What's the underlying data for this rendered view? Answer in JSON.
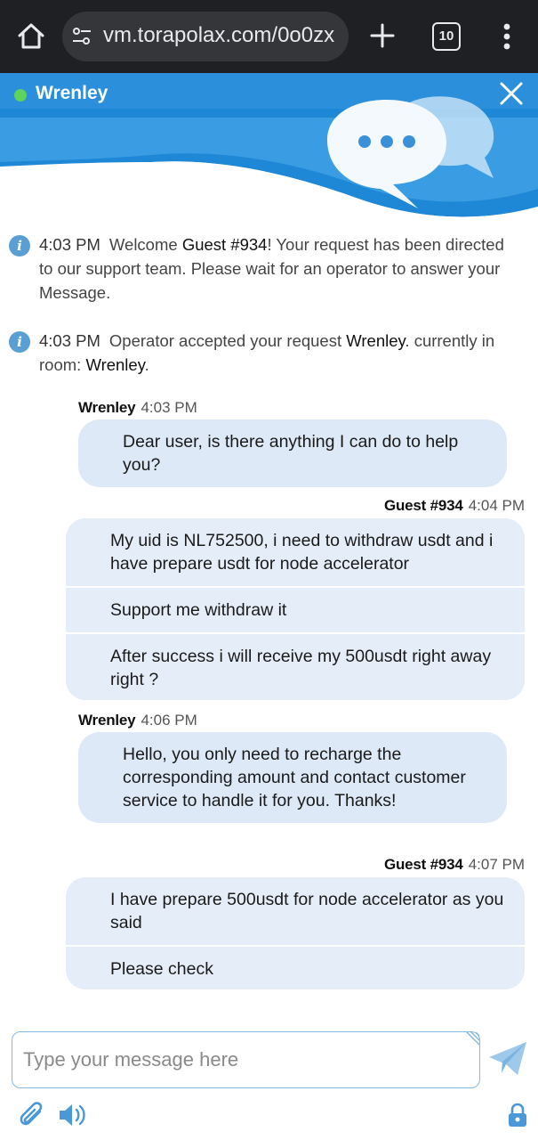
{
  "browser": {
    "url": "vm.torapolax.com/0o0zx",
    "tab_count": "10",
    "icons": [
      "home-icon",
      "site-settings-icon",
      "plus-icon",
      "tabs-icon",
      "more-vert-icon"
    ]
  },
  "header": {
    "agent_name": "Wrenley",
    "status_color": "#5ed45c",
    "accent_color": "#1f88d6"
  },
  "system_messages": [
    {
      "time": "4:03 PM",
      "text_a": "Welcome ",
      "highlight": "Guest #934",
      "text_b": "! Your request has been directed to our support team. Please wait for an operator to answer your Message."
    },
    {
      "time": "4:03 PM",
      "text_a": "Operator accepted your request ",
      "highlight": "Wrenley",
      "text_b": ". currently in room: ",
      "highlight2": "Wrenley",
      "text_c": "."
    }
  ],
  "conversation": [
    {
      "sender": "Wrenley",
      "time": "4:03 PM",
      "messages": [
        "Dear user, is there anything I can do to help you?"
      ]
    },
    {
      "sender": "Guest #934",
      "time": "4:04 PM",
      "messages": [
        "My uid is NL752500, i need to withdraw usdt and i have prepare usdt for node accelerator",
        "Support me withdraw it",
        "After success i will receive my 500usdt right away right ?"
      ]
    },
    {
      "sender": "Wrenley",
      "time": "4:06 PM",
      "messages": [
        "Hello, you only need to recharge the corresponding amount and contact customer service to handle it for you. Thanks!"
      ]
    },
    {
      "sender": "Guest #934",
      "time": "4:07 PM",
      "messages": [
        "I have prepare 500usdt for node accelerator as you said",
        "Please check"
      ]
    }
  ],
  "composer": {
    "placeholder": "Type your message here",
    "icons": [
      "send-icon",
      "attach-icon",
      "sound-icon",
      "lock-icon"
    ]
  }
}
